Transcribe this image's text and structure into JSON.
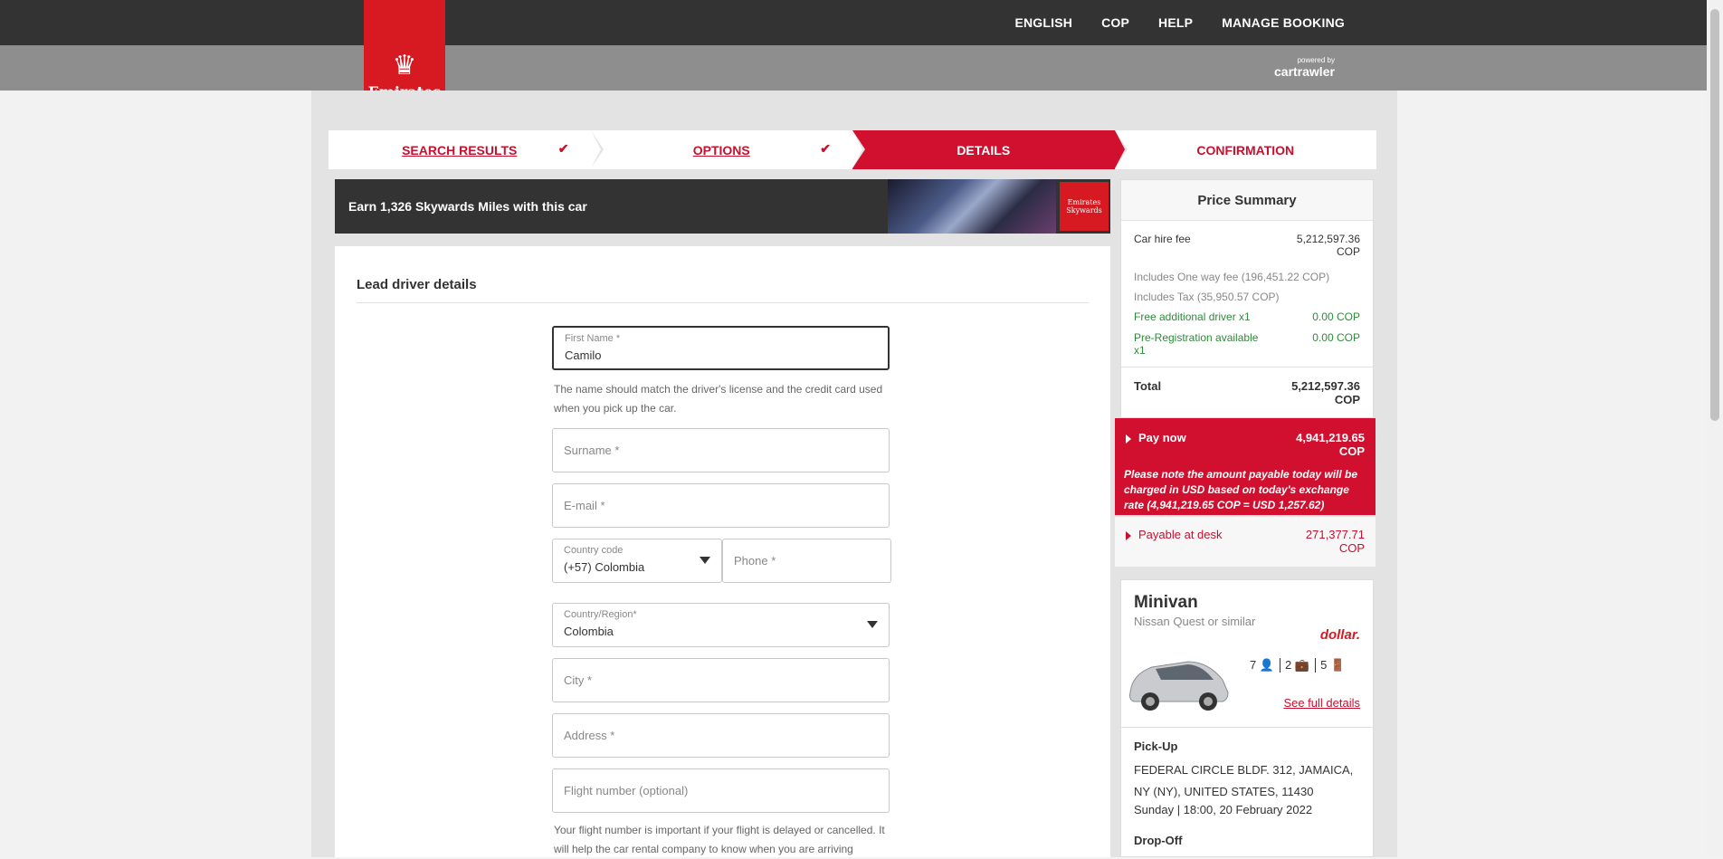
{
  "topnav": {
    "items": [
      "ENGLISH",
      "COP",
      "HELP",
      "MANAGE BOOKING"
    ]
  },
  "brand": {
    "name": "Emirates",
    "powered_by": "powered by",
    "partner": "cartrawler"
  },
  "steps": [
    {
      "label": "SEARCH RESULTS",
      "state": "done"
    },
    {
      "label": "OPTIONS",
      "state": "done"
    },
    {
      "label": "DETAILS",
      "state": "active"
    },
    {
      "label": "CONFIRMATION",
      "state": "pending"
    }
  ],
  "skywards": {
    "text": "Earn 1,326 Skywards Miles with this car",
    "badge_line1": "Emirates",
    "badge_line2": "Skywards"
  },
  "form": {
    "title": "Lead driver details",
    "first_name_label": "First Name *",
    "first_name_value": "Camilo",
    "name_help": "The name should match the driver's license and the credit card used when you pick up the car.",
    "surname_placeholder": "Surname *",
    "email_placeholder": "E-mail *",
    "country_code_label": "Country code",
    "country_code_value": "(+57) Colombia",
    "phone_placeholder": "Phone *",
    "country_region_label": "Country/Region*",
    "country_region_value": "Colombia",
    "city_placeholder": "City *",
    "address_placeholder": "Address *",
    "flight_placeholder": "Flight number (optional)",
    "flight_help": "Your flight number is important if your flight is delayed or cancelled. It will help the car rental company to know when you are arriving"
  },
  "summary": {
    "title": "Price Summary",
    "car_hire_label": "Car hire fee",
    "car_hire_value": "5,212,597.36",
    "currency": "COP",
    "one_way": "Includes One way fee (196,451.22 COP)",
    "tax": "Includes Tax (35,950.57 COP)",
    "free_driver_label": "Free additional driver x1",
    "free_driver_value": "0.00 COP",
    "prereg_label": "Pre-Registration available x1",
    "prereg_value": "0.00 COP",
    "total_label": "Total",
    "total_value": "5,212,597.36",
    "pay_now_label": "Pay now",
    "pay_now_value": "4,941,219.65",
    "pay_now_note": "Please note the amount payable today will be charged in USD based on today's exchange rate (4,941,219.65 COP = USD 1,257.62)",
    "pay_desk_label": "Payable at desk",
    "pay_desk_value": "271,377.71"
  },
  "car": {
    "category": "Minivan",
    "model": "Nissan Quest or similar",
    "supplier": "dollar.",
    "seats": "7",
    "bags": "2",
    "doors": "5",
    "details_link": "See full details",
    "pickup_title": "Pick-Up",
    "pickup_address": "FEDERAL CIRCLE BLDF. 312, JAMAICA, NY (NY), UNITED STATES, 11430",
    "pickup_time": "Sunday | 18:00, 20 February 2022",
    "dropoff_title": "Drop-Off"
  }
}
